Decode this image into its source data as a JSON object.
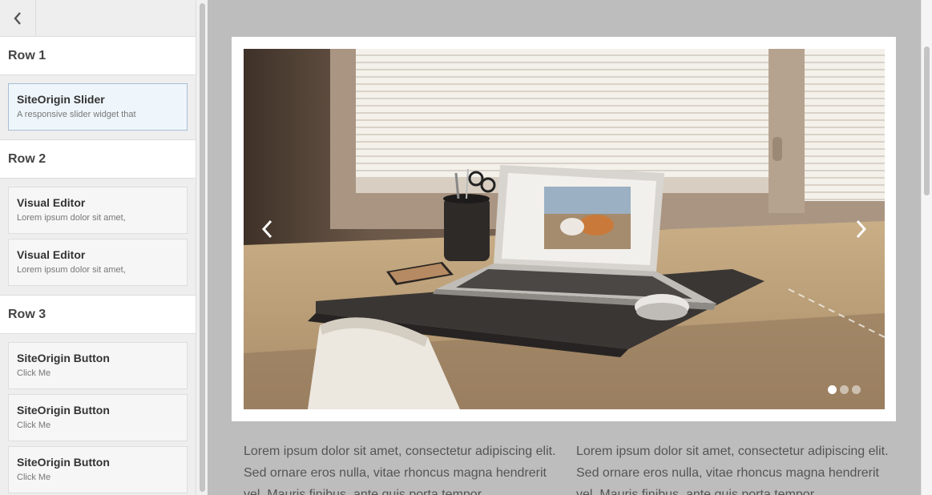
{
  "sidebar": {
    "back_icon": "chevron-left-icon",
    "rows": [
      {
        "label": "Row 1",
        "widgets": [
          {
            "title": "SiteOrigin Slider",
            "desc": "A responsive slider widget that"
          }
        ]
      },
      {
        "label": "Row 2",
        "widgets": [
          {
            "title": "Visual Editor",
            "desc": "Lorem ipsum dolor sit amet,"
          },
          {
            "title": "Visual Editor",
            "desc": "Lorem ipsum dolor sit amet,"
          }
        ]
      },
      {
        "label": "Row 3",
        "widgets": [
          {
            "title": "SiteOrigin Button",
            "desc": "Click Me"
          },
          {
            "title": "SiteOrigin Button",
            "desc": "Click Me"
          },
          {
            "title": "SiteOrigin Button",
            "desc": "Click Me"
          }
        ]
      }
    ]
  },
  "slider": {
    "prev_icon": "chevron-left-icon",
    "next_icon": "chevron-right-icon",
    "slide_count": 3,
    "active_slide": 1
  },
  "content": {
    "col1": "Lorem ipsum dolor sit amet, consectetur adipiscing elit. Sed ornare eros nulla, vitae rhoncus magna hendrerit vel. Mauris finibus, ante quis porta tempor,",
    "col2": "Lorem ipsum dolor sit amet, consectetur adipiscing elit. Sed ornare eros nulla, vitae rhoncus magna hendrerit vel. Mauris finibus, ante quis porta tempor,"
  },
  "colors": {
    "active_card_bg": "#eff6fb",
    "active_card_border": "#a7bdd3",
    "preview_bg": "#bdbdbd"
  }
}
